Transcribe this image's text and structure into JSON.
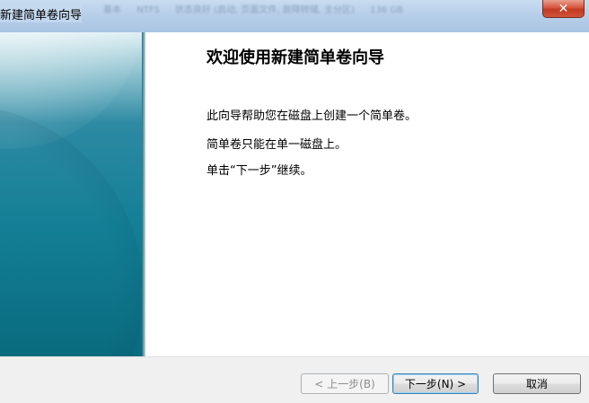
{
  "window": {
    "title": "新建简单卷向导",
    "close_glyph": "✕",
    "background_blur_text": [
      "基本",
      "NTFS",
      "状态良好 (启动, 页面文件, 故障转储, 主分区)",
      "136 GB"
    ]
  },
  "wizard": {
    "heading": "欢迎使用新建简单卷向导",
    "paragraphs": [
      "此向导帮助您在磁盘上创建一个简单卷。",
      "简单卷只能在单一磁盘上。",
      "单击“下一步”继续。"
    ]
  },
  "buttons": {
    "back": "< 上一步(B)",
    "next": "下一步(N) >",
    "cancel": "取消"
  },
  "colors": {
    "titlebar": "#b7cfe9",
    "side_panel": "#137f96",
    "close_button": "#c23a22",
    "footer": "#f0f0f0"
  }
}
